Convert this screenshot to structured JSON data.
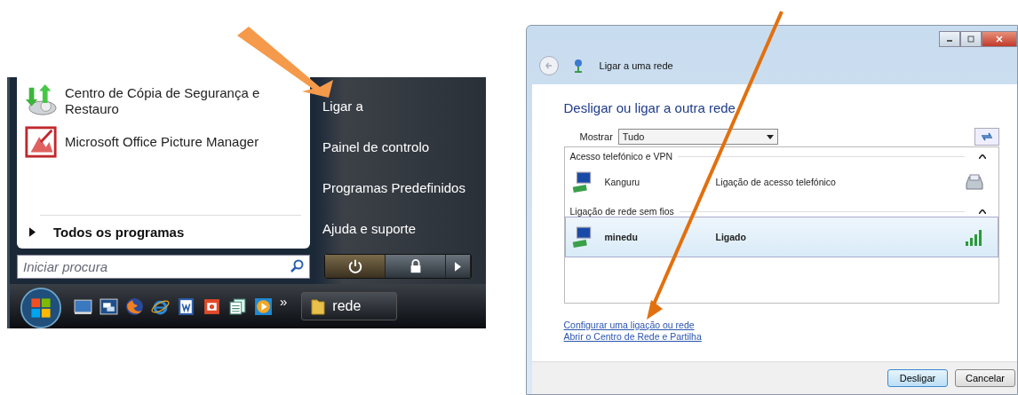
{
  "start_menu": {
    "programs": [
      {
        "label": "Centro de Cópia de Segurança e Restauro",
        "kind": "backup"
      },
      {
        "label": "Microsoft Office Picture Manager",
        "kind": "picture"
      }
    ],
    "all_programs": "Todos os programas",
    "search": {
      "placeholder": "Iniciar procura"
    },
    "places": [
      {
        "label": "Ligar a"
      },
      {
        "label": "Painel de controlo"
      },
      {
        "label": "Programas Predefinidos"
      },
      {
        "label": "Ajuda e suporte"
      }
    ]
  },
  "taskbar": {
    "more": "»",
    "tasks": [
      {
        "label": "rede"
      }
    ]
  },
  "dialog": {
    "title": "Ligar a uma rede",
    "heading": "Desligar ou ligar a outra rede",
    "filter": {
      "label": "Mostrar",
      "value": "Tudo"
    },
    "groups": [
      {
        "name": "Acesso telefónico e VPN",
        "expanded": true,
        "connections": [
          {
            "name": "Kanguru",
            "status": "Ligação de acesso telefónico",
            "kind": "dialup",
            "selected": false
          }
        ]
      },
      {
        "name": "Ligação de rede sem fios",
        "expanded": true,
        "connections": [
          {
            "name": "minedu",
            "status": "Ligado",
            "kind": "wireless",
            "selected": true
          }
        ]
      }
    ],
    "links": [
      "Configurar uma ligação ou rede",
      "Abrir o Centro de Rede e Partilha"
    ],
    "buttons": [
      {
        "label": "Desligar",
        "default": true
      },
      {
        "label": "Cancelar",
        "default": false
      }
    ]
  }
}
